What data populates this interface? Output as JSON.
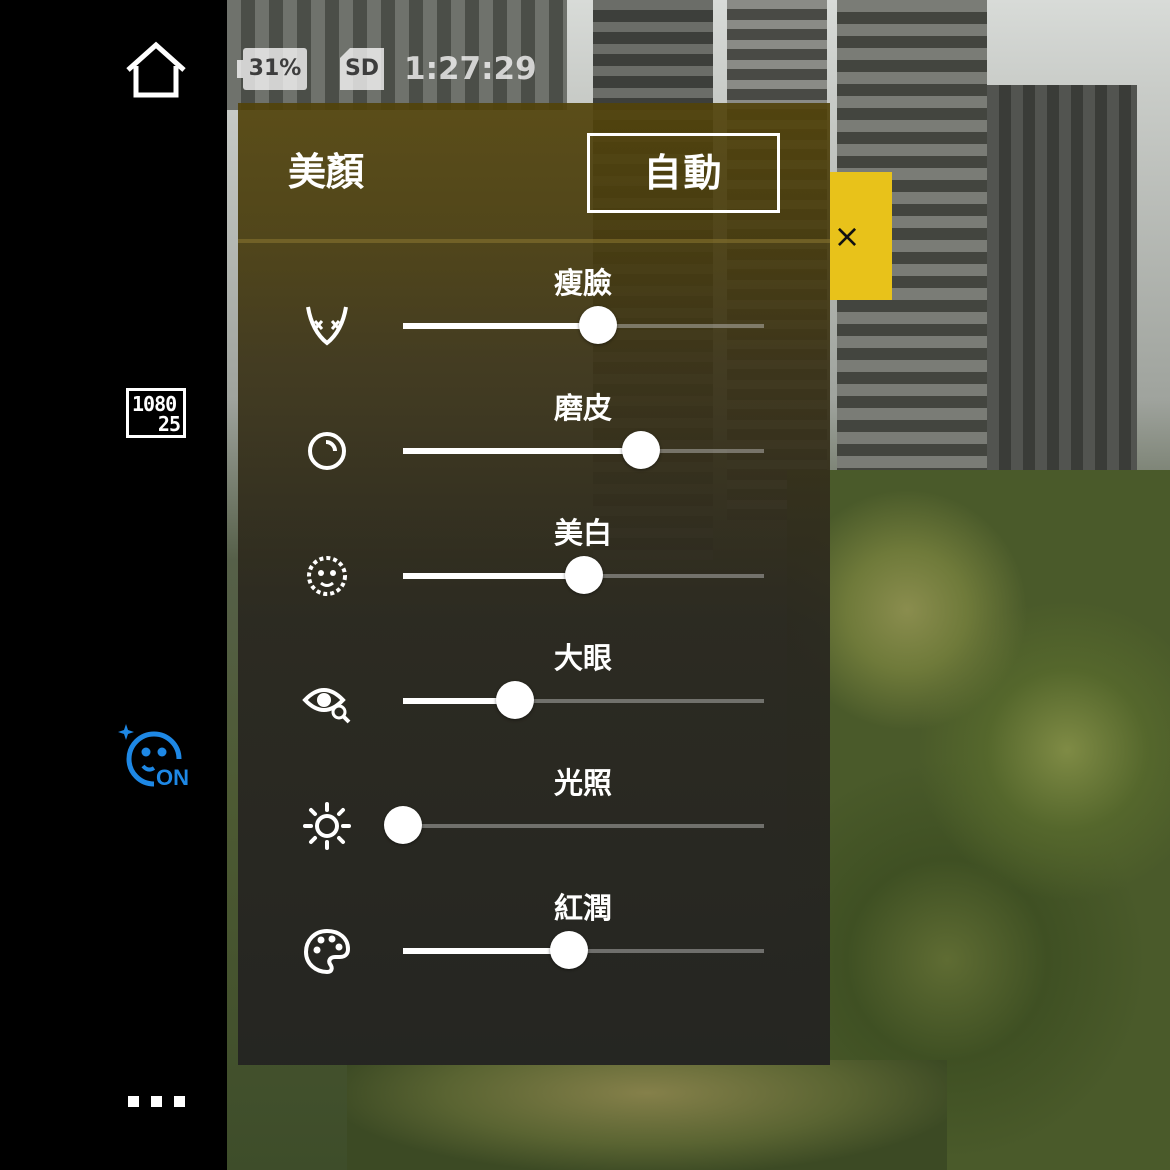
{
  "status_bar": {
    "battery": "31%",
    "storage": "SD",
    "time": "1:27:29"
  },
  "sidebar": {
    "home_icon": "home-icon",
    "resolution": {
      "line1": "1080",
      "line2": "25"
    },
    "beauty_mode": {
      "icon": "beauty-face-icon",
      "state": "ON",
      "color": "#1e88e5"
    },
    "more_icon": "more-dots-icon"
  },
  "panel": {
    "title": "美顏",
    "auto_label": "自動",
    "close_glyph": "×",
    "accent_color": "#e8c21a",
    "sliders": [
      {
        "label": "瘦臉",
        "icon": "face-slim-icon",
        "value": 0.54
      },
      {
        "label": "磨皮",
        "icon": "skin-smooth-icon",
        "value": 0.66
      },
      {
        "label": "美白",
        "icon": "whitening-icon",
        "value": 0.5
      },
      {
        "label": "大眼",
        "icon": "big-eye-icon",
        "value": 0.31
      },
      {
        "label": "光照",
        "icon": "lighting-icon",
        "value": 0.0
      },
      {
        "label": "紅潤",
        "icon": "rosy-palette-icon",
        "value": 0.46
      }
    ]
  }
}
